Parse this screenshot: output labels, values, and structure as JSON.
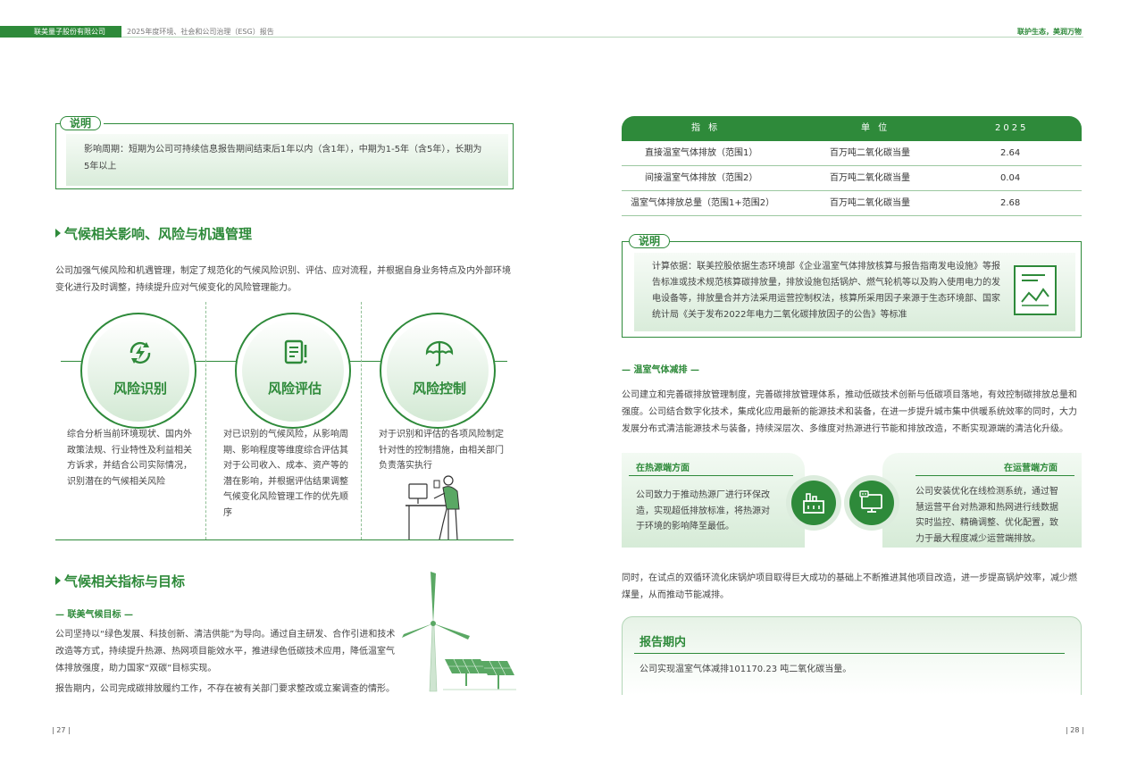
{
  "header": {
    "company": "联美量子股份有限公司",
    "report_title": "2025年度环境、社会和公司治理（ESG）报告",
    "slogan": "联护生态，美润万物"
  },
  "left": {
    "note": {
      "label": "说明",
      "text": "影响周期：短期为公司可持续信息报告期间结束后1年以内（含1年），中期为1-5年（含5年），长期为5年以上"
    },
    "section1": {
      "title": "气候相关影响、风险与机遇管理",
      "intro": "公司加强气候风险和机遇管理，制定了规范化的气候风险识别、评估、应对流程，并根据自身业务特点及内外部环境变化进行及时调整，持续提升应对气候变化的风险管理能力。",
      "steps": [
        {
          "title": "风险识别",
          "icon": "lightning-recycle-icon",
          "text": "综合分析当前环境现状、国内外政策法规、行业特性及利益相关方诉求，并结合公司实际情况，识别潜在的气候相关风险"
        },
        {
          "title": "风险评估",
          "icon": "document-alert-icon",
          "text": "对已识别的气候风险，从影响周期、影响程度等维度综合评估其对于公司收入、成本、资产等的潜在影响，并根据评估结果调整气候变化风险管理工作的优先顺序"
        },
        {
          "title": "风险控制",
          "icon": "umbrella-icon",
          "text": "对于识别和评估的各项风险制定针对性的控制措施，由相关部门负责落实执行"
        }
      ]
    },
    "section2": {
      "title": "气候相关指标与目标",
      "subtitle": "— 联美气候目标 —",
      "para1": "公司坚持以“绿色发展、科技创新、清洁供能”为导向。通过自主研发、合作引进和技术改造等方式，持续提升热源、热网项目能效水平，推进绿色低碳技术应用，降低温室气体排放强度，助力国家“双碳”目标实现。",
      "para2": "报告期内，公司完成碳排放履约工作，不存在被有关部门要求整改或立案调查的情形。"
    },
    "page_number": "27"
  },
  "right": {
    "table": {
      "headers": [
        "指 标",
        "单 位",
        "2025"
      ],
      "rows": [
        [
          "直接温室气体排放（范围1）",
          "百万吨二氧化碳当量",
          "2.64"
        ],
        [
          "间接温室气体排放（范围2）",
          "百万吨二氧化碳当量",
          "0.04"
        ],
        [
          "温室气体排放总量（范围1+范围2）",
          "百万吨二氧化碳当量",
          "2.68"
        ]
      ]
    },
    "note": {
      "label": "说明",
      "text": "计算依据：联美控股依据生态环境部《企业温室气体排放核算与报告指南发电设施》等报告标准或技术规范核算碳排放量，排放设施包括锅炉、燃气轮机等以及购入使用电力的发电设备等，排放量合并方法采用运营控制权法，核算所采用因子来源于生态环境部、国家统计局《关于发布2022年电力二氧化碳排放因子的公告》等标准",
      "icon": "chart-document-icon"
    },
    "reduction": {
      "subtitle": "— 温室气体减排 —",
      "intro": "公司建立和完善碳排放管理制度，完善碳排放管理体系，推动低碳技术创新与低碳项目落地，有效控制碳排放总量和强度。公司结合数字化技术，集成化应用最新的能源技术和装备，在进一步提升城市集中供暖系统效率的同时，大力发展分布式清洁能源技术与装备，持续深层次、多维度对热源进行节能和排放改造，不断实现源端的清洁化升级。",
      "card_left": {
        "title": "在热源端方面",
        "text": "公司致力于推动热源厂进行环保改造，实现超低排放标准，将热源对于环境的影响降至最低。",
        "icon": "factory-icon"
      },
      "card_right": {
        "title": "在运营端方面",
        "text": "公司安装优化在线检测系统，通过智慧运营平台对热源和热网进行线数据实时监控、精确调整、优化配置，致力于最大程度减少运营端排放。",
        "icon": "monitor-icon"
      },
      "para2": "同时，在试点的双循环流化床锅炉项目取得巨大成功的基础上不断推进其他项目改造，进一步提高锅炉效率，减少燃煤量，从而推动节能减排。"
    },
    "report_period": {
      "title": "报告期内",
      "text": "公司实现温室气体减排101170.23 吨二氧化碳当量。"
    },
    "page_number": "28"
  }
}
